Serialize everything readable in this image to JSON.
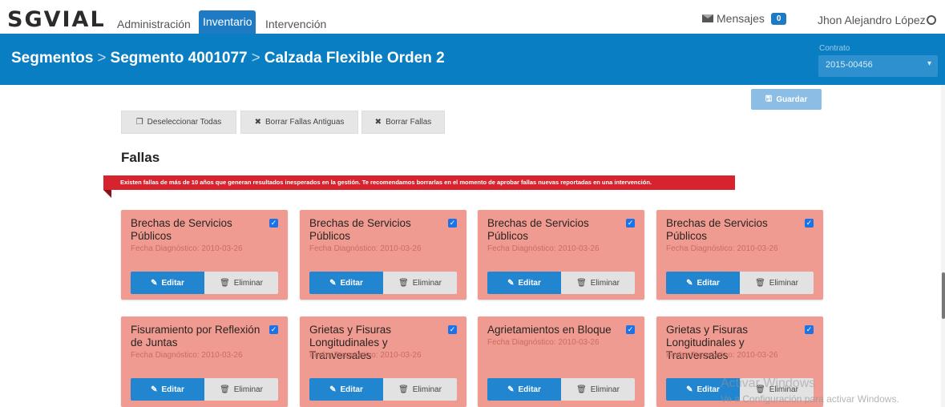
{
  "app": {
    "logo": "SGVIAL"
  },
  "nav": {
    "items": [
      {
        "label": "Administración",
        "active": false
      },
      {
        "label": "Inventario",
        "active": true
      },
      {
        "label": "Intervención",
        "active": false
      }
    ],
    "messages_label": "Mensajes",
    "messages_count": "0",
    "user_name": "Jhon Alejandro López"
  },
  "header": {
    "breadcrumb": [
      "Segmentos",
      "Segmento 4001077",
      "Calzada Flexible Orden 2"
    ],
    "contract_label": "Contrato",
    "contract_value": "2015-00456"
  },
  "toolbar": {
    "deselect_all": "Deseleccionar Todas",
    "delete_old": "Borrar Fallas Antiguas",
    "delete_faults": "Borrar Fallas",
    "save": "Guardar"
  },
  "section": {
    "title": "Fallas",
    "alert": "Existen fallas de más de 10 años que generan resultados inesperados en la gestión. Te recomendamos borrarlas en el momento de aprobar fallas nuevas reportadas en una intervención."
  },
  "cards": [
    {
      "title": "Brechas de Servicios Públicos",
      "date": "Fecha Diagnóstico: 2010-03-26",
      "checked": true
    },
    {
      "title": "Brechas de Servicios Públicos",
      "date": "Fecha Diagnóstico: 2010-03-26",
      "checked": true
    },
    {
      "title": "Brechas de Servicios Públicos",
      "date": "Fecha Diagnóstico: 2010-03-26",
      "checked": true
    },
    {
      "title": "Brechas de Servicios Públicos",
      "date": "Fecha Diagnóstico: 2010-03-26",
      "checked": true
    },
    {
      "title": "Fisuramiento por Reflexión de Juntas",
      "date": "Fecha Diagnóstico: 2010-03-26",
      "checked": true
    },
    {
      "title": "Grietas y Fisuras Longitudinales y Tranversales",
      "date": "Fecha Diagnóstico: 2010-03-26",
      "checked": true
    },
    {
      "title": "Agrietamientos en Bloque",
      "date": "Fecha Diagnóstico: 2010-03-26",
      "checked": true
    },
    {
      "title": "Grietas y Fisuras Longitudinales y Tranversales",
      "date": "Fecha Diagnóstico: 2010-03-26",
      "checked": true
    }
  ],
  "card_actions": {
    "edit": "Editar",
    "delete": "Eliminar"
  },
  "watermark": {
    "line1": "Activar Windows",
    "line2": "Ve a Configuración para activar Windows."
  },
  "colors": {
    "primary": "#0a7ec2",
    "card": "#f09b92",
    "alert": "#d7232e",
    "button": "#2185d0"
  },
  "icons": {
    "envelope": "envelope-icon",
    "user": "user-circle-icon",
    "copy": "copy-icon",
    "close": "x-icon",
    "edit": "edit-icon",
    "trash": "trash-icon",
    "save": "floppy-icon",
    "check": "check-icon"
  }
}
